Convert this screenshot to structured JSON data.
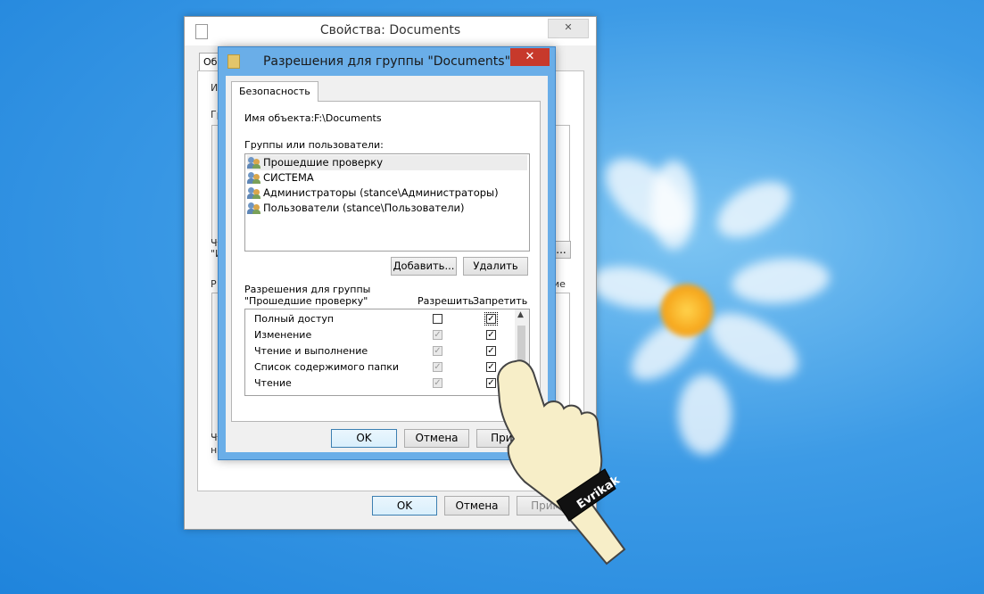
{
  "back_window": {
    "title": "Свойства: Documents",
    "close": "✕",
    "tab_fragment": "Об",
    "frag_im": "Им",
    "frag_gr": "Гр",
    "frag_ch": "Ч",
    "frag_quote": "\"И",
    "frag_r": "Р",
    "frag_ch2": "Ч",
    "frag_na": "на",
    "frag_ellipsis": "...",
    "frag_ie": "ие",
    "ok": "OK",
    "cancel": "Отмена",
    "apply": "Приме"
  },
  "dialog": {
    "title": "Разрешения для группы \"Documents\"",
    "close": "✕",
    "tab": "Безопасность",
    "object_label": "Имя объекта:",
    "object_value": "F:\\Documents",
    "groups_label": "Группы или пользователи:",
    "users": [
      "Прошедшие проверку",
      "СИСТЕМА",
      "Администраторы (stance\\Администраторы)",
      "Пользователи (stance\\Пользователи)"
    ],
    "add": "Добавить...",
    "remove": "Удалить",
    "perms_label_line1": "Разрешения для группы",
    "perms_label_line2": "\"Прошедшие проверку\"",
    "allow_header": "Разрешить",
    "deny_header": "Запретить",
    "permissions": [
      {
        "name": "Полный доступ",
        "allow": false,
        "deny": true
      },
      {
        "name": "Изменение",
        "allow": true,
        "deny": true
      },
      {
        "name": "Чтение и выполнение",
        "allow": true,
        "deny": true
      },
      {
        "name": "Список содержимого папки",
        "allow": true,
        "deny": true
      },
      {
        "name": "Чтение",
        "allow": true,
        "deny": true
      }
    ],
    "ok": "OK",
    "cancel": "Отмена",
    "apply": "Приме"
  },
  "watermark": "Evrikak",
  "colors": {
    "dialog_frame": "#6aaee8",
    "close_red": "#c7392b",
    "desktop": "#3d9be6"
  }
}
